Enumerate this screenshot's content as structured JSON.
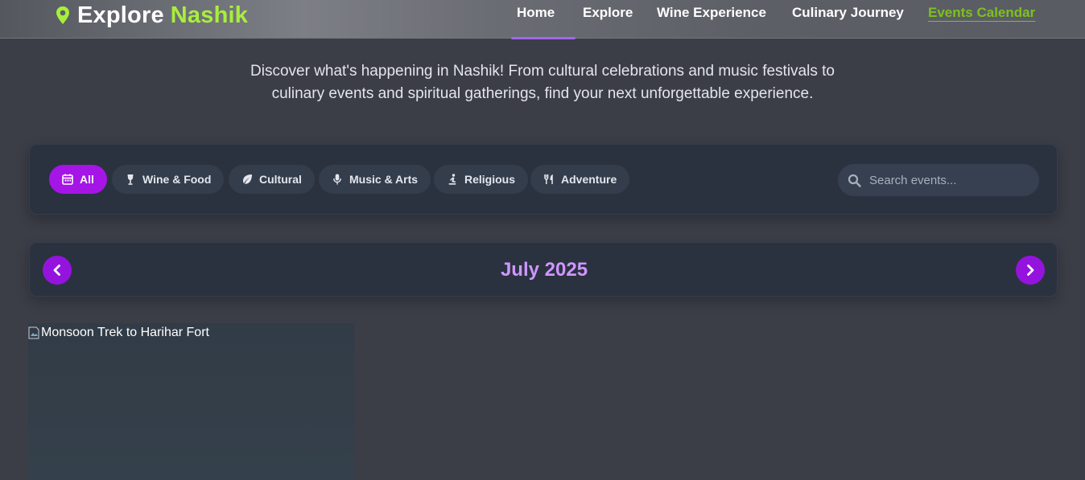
{
  "header": {
    "logo": {
      "word1": "Explore",
      "word2": "Nashik",
      "icon": "map-pin-icon",
      "accent": "#a8ef3b"
    },
    "nav": [
      {
        "label": "Home",
        "active": false
      },
      {
        "label": "Explore",
        "active": false
      },
      {
        "label": "Wine Experience",
        "active": false
      },
      {
        "label": "Culinary Journey",
        "active": false
      },
      {
        "label": "Events Calendar",
        "active": true
      }
    ]
  },
  "intro": {
    "line1": "Discover what's happening in Nashik! From cultural celebrations and music festivals to",
    "line2": "culinary events and spiritual gatherings, find your next unforgettable experience."
  },
  "filters": {
    "chips": [
      {
        "label": "All",
        "icon": "calendar-icon",
        "active": true
      },
      {
        "label": "Wine & Food",
        "icon": "wine-glass-icon",
        "active": false
      },
      {
        "label": "Cultural",
        "icon": "leaf-icon",
        "active": false
      },
      {
        "label": "Music & Arts",
        "icon": "microphone-icon",
        "active": false
      },
      {
        "label": "Religious",
        "icon": "praying-icon",
        "active": false
      },
      {
        "label": "Adventure",
        "icon": "utensils-icon",
        "active": false
      }
    ],
    "search": {
      "placeholder": "Search events...",
      "value": "",
      "icon": "search-icon"
    }
  },
  "calendar": {
    "month": "July 2025",
    "prev_icon": "chevron-left-icon",
    "next_icon": "chevron-right-icon"
  },
  "events": [
    {
      "image_alt": "Monsoon Trek to Harihar Fort"
    }
  ],
  "colors": {
    "active_chip": "#a515e6",
    "month_label": "#cf96ff",
    "active_nav": "#7dc11d",
    "panel": "#2a3240"
  }
}
